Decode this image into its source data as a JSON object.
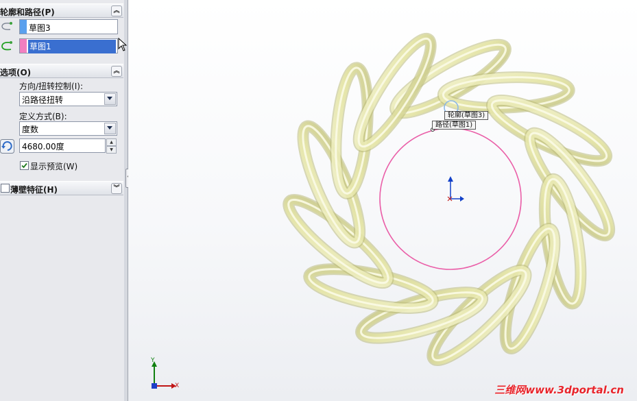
{
  "profile_path_section": {
    "title": "轮廓和路径(P)",
    "profile": {
      "value": "草图3",
      "color": "#5aa0ee"
    },
    "path": {
      "value": "草图1",
      "color": "#f27fc0"
    }
  },
  "options_section": {
    "title": "选项(O)",
    "orientation_label": "方向/扭转控制(I):",
    "orientation_value": "沿路径扭转",
    "define_label": "定义方式(B):",
    "define_value": "度数",
    "twist_value": "4680.00度",
    "preview_label": "显示预览(W)",
    "preview_checked": true
  },
  "thin_section": {
    "title": "薄壁特征(H)",
    "checked": false
  },
  "viewport": {
    "callout_profile": "轮廓(草图3)",
    "callout_path": "路径(草图1)",
    "triad": {
      "x": "X",
      "y": "Y"
    },
    "circle_color": "#ea5fa8",
    "coil_color": "#eeeeb0"
  },
  "watermark": "三维网www.3dportal.cn"
}
